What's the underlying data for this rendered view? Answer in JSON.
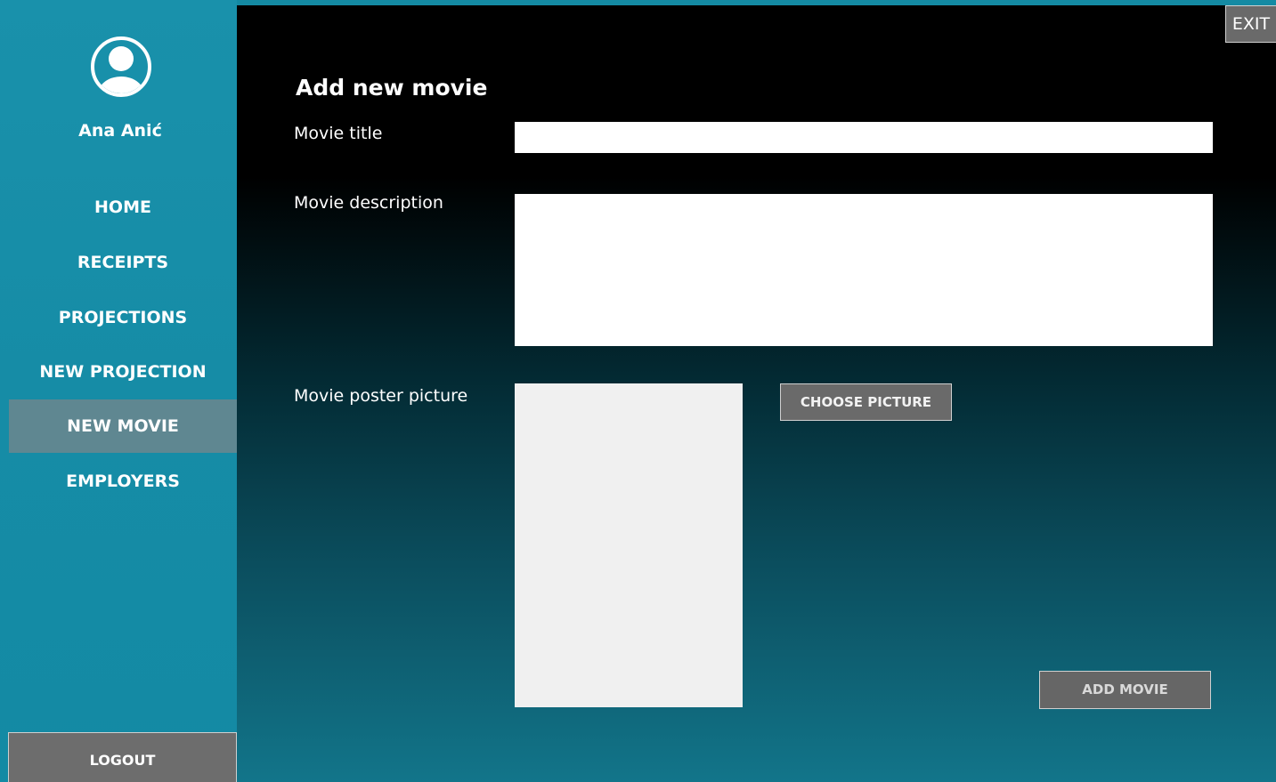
{
  "sidebar": {
    "user_name": "Ana Anić",
    "avatar_icon": "user-circle-icon",
    "items": [
      {
        "label": "HOME"
      },
      {
        "label": "RECEIPTS"
      },
      {
        "label": "PROJECTIONS"
      },
      {
        "label": "NEW PROJECTION"
      },
      {
        "label": "NEW MOVIE",
        "active": true
      },
      {
        "label": "EMPLOYERS"
      }
    ],
    "logout_label": "LOGOUT"
  },
  "header": {
    "exit_label": "EXIT"
  },
  "form": {
    "title": "Add new movie",
    "movie_title_label": "Movie title",
    "movie_title_value": "",
    "movie_description_label": "Movie description",
    "movie_description_value": "",
    "movie_poster_label": "Movie poster picture",
    "choose_picture_label": "CHOOSE PICTURE",
    "add_movie_label": "ADD MOVIE"
  },
  "colors": {
    "sidebar": "#168ca6",
    "active_item": "#5f8791",
    "button": "#6a6a6a"
  }
}
